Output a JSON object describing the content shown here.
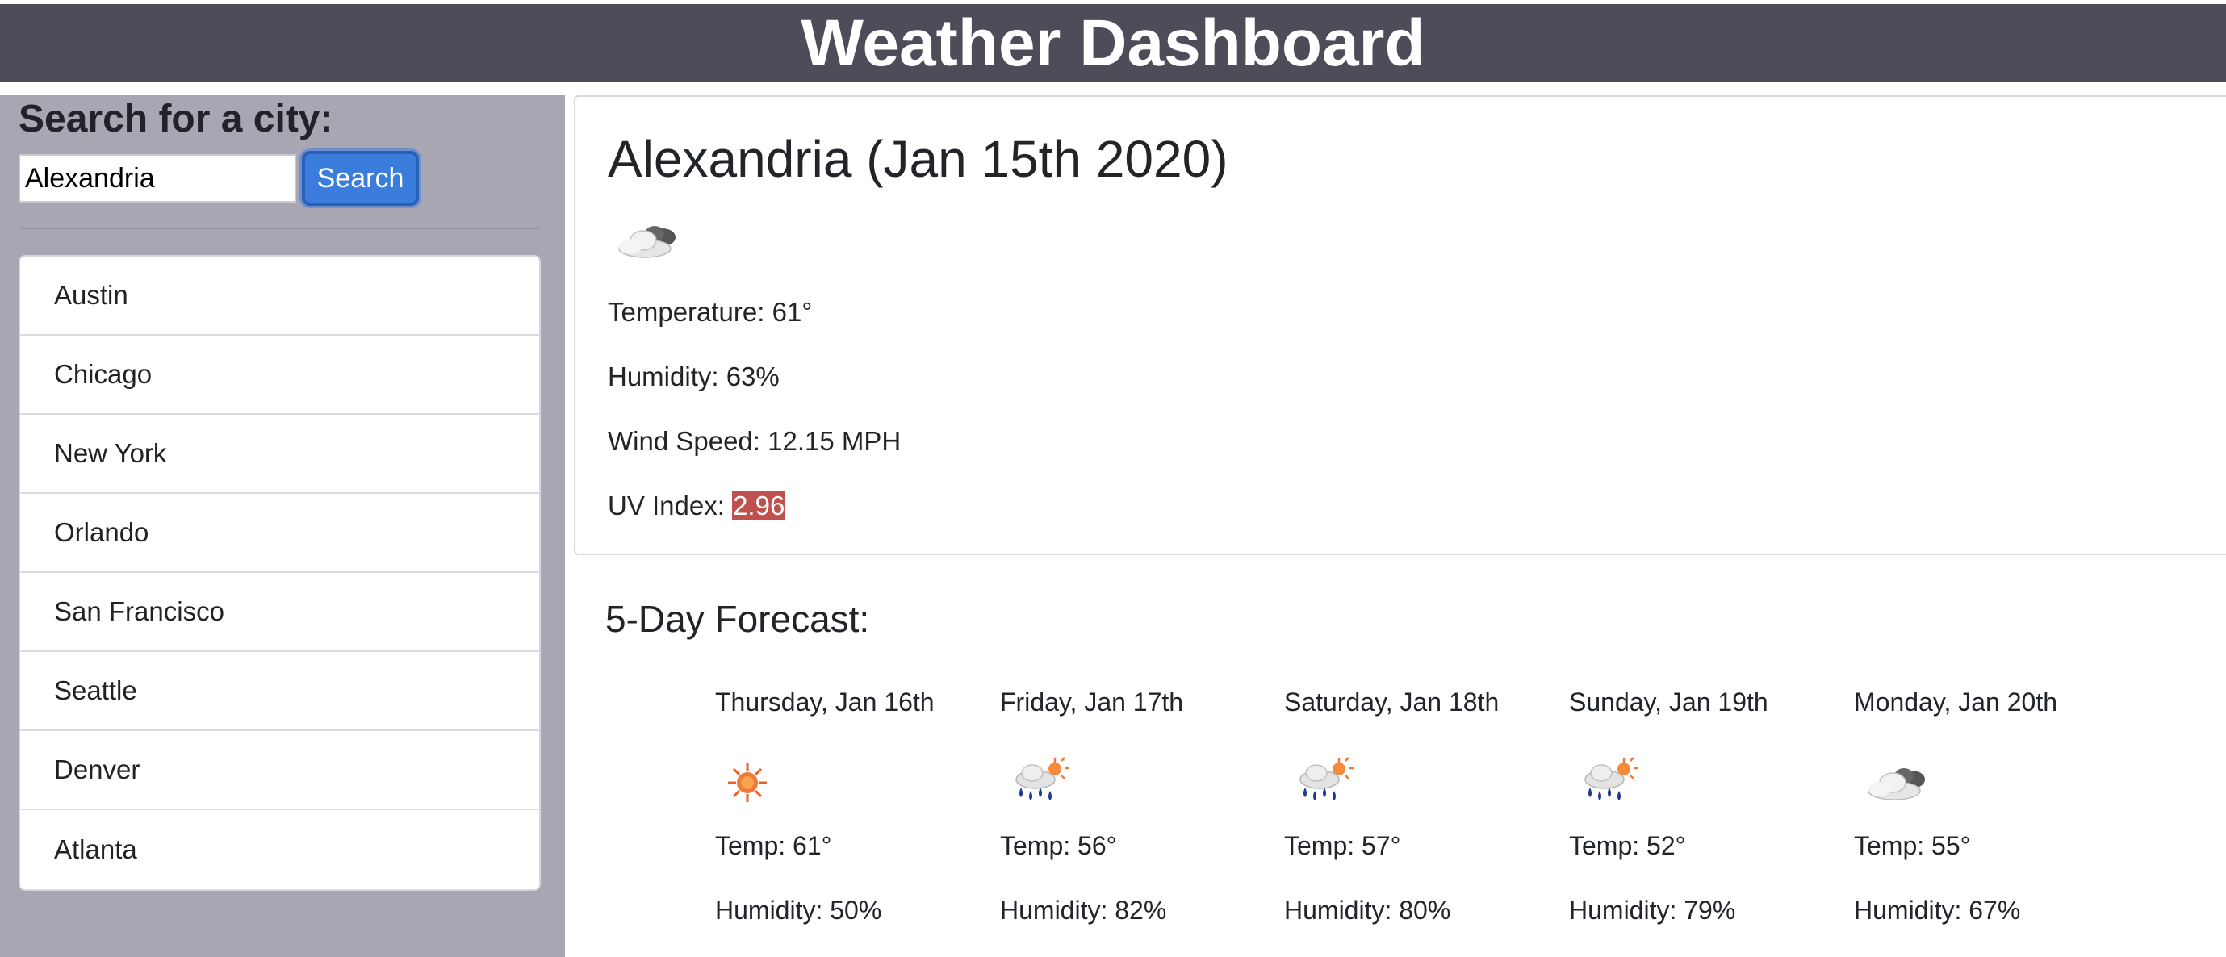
{
  "header": {
    "title": "Weather Dashboard"
  },
  "search": {
    "heading": "Search for a city:",
    "input_value": "Alexandria",
    "button_label": "Search"
  },
  "cities": [
    "Austin",
    "Chicago",
    "New York",
    "Orlando",
    "San Francisco",
    "Seattle",
    "Denver",
    "Atlanta"
  ],
  "current": {
    "title": "Alexandria (Jan 15th 2020)",
    "icon": "cloudy-icon",
    "temperature": "Temperature: 61°",
    "humidity": "Humidity: 63%",
    "wind": "Wind Speed: 12.15 MPH",
    "uv_label": "UV Index: ",
    "uv_value": "2.96",
    "uv_color": "#c0504d"
  },
  "forecast": {
    "heading": "5-Day Forecast:",
    "days": [
      {
        "date": "Thursday, Jan 16th",
        "icon": "sun-icon",
        "temp": "Temp: 61°",
        "humidity": "Humidity: 50%"
      },
      {
        "date": "Friday, Jan 17th",
        "icon": "rain-sun-icon",
        "temp": "Temp: 56°",
        "humidity": "Humidity: 82%"
      },
      {
        "date": "Saturday, Jan 18th",
        "icon": "rain-sun-icon",
        "temp": "Temp: 57°",
        "humidity": "Humidity: 80%"
      },
      {
        "date": "Sunday, Jan 19th",
        "icon": "rain-sun-icon",
        "temp": "Temp: 52°",
        "humidity": "Humidity: 79%"
      },
      {
        "date": "Monday, Jan 20th",
        "icon": "cloudy-icon",
        "temp": "Temp: 55°",
        "humidity": "Humidity: 67%"
      }
    ]
  },
  "colors": {
    "header_bg": "#4d4d5a",
    "sidebar_bg": "#a8a6b3",
    "button_bg": "#3b7ddd"
  }
}
